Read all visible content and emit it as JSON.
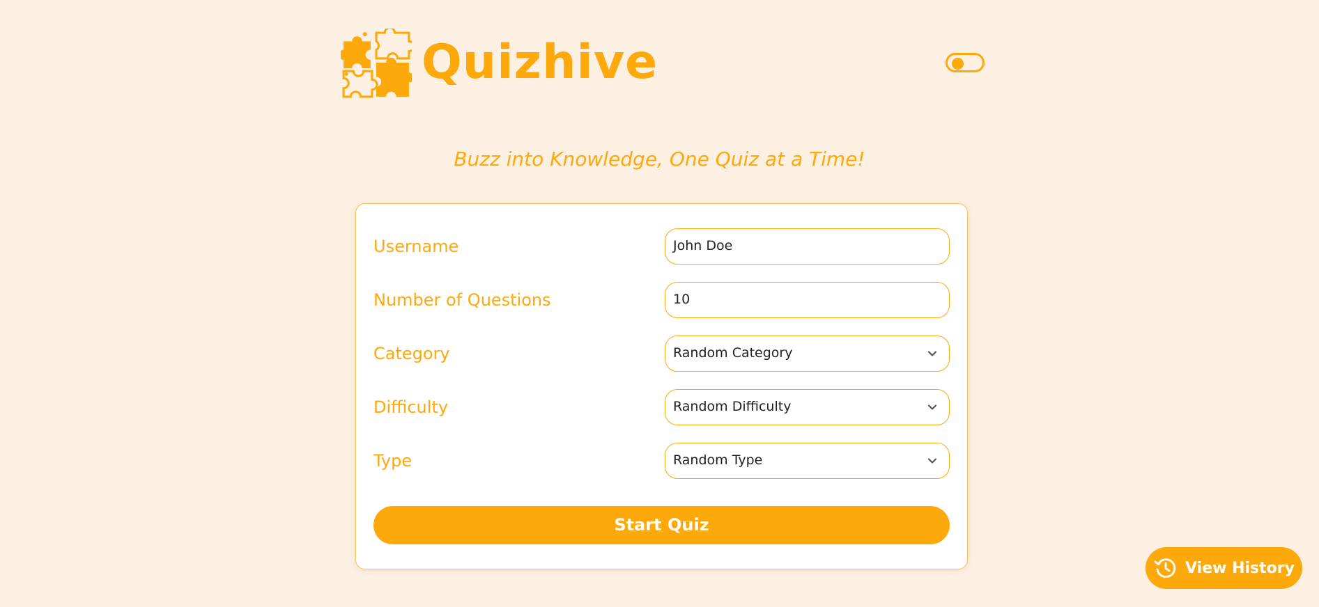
{
  "app": {
    "name": "Quizhive",
    "tagline": "Buzz into Knowledge, One Quiz at a Time!",
    "accent_color": "#fda90c",
    "background_color": "#fcf0e3"
  },
  "header": {
    "logo_icon": "puzzle-pieces-icon",
    "theme_toggle": {
      "state": "off"
    }
  },
  "form": {
    "username": {
      "label": "Username",
      "value": "John Doe"
    },
    "num_questions": {
      "label": "Number of Questions",
      "value": "10"
    },
    "category": {
      "label": "Category",
      "value": "Random Category"
    },
    "difficulty": {
      "label": "Difficulty",
      "value": "Random Difficulty"
    },
    "type": {
      "label": "Type",
      "value": "Random Type"
    },
    "start_label": "Start Quiz"
  },
  "history": {
    "label": "View History",
    "icon": "history-clock-icon"
  }
}
